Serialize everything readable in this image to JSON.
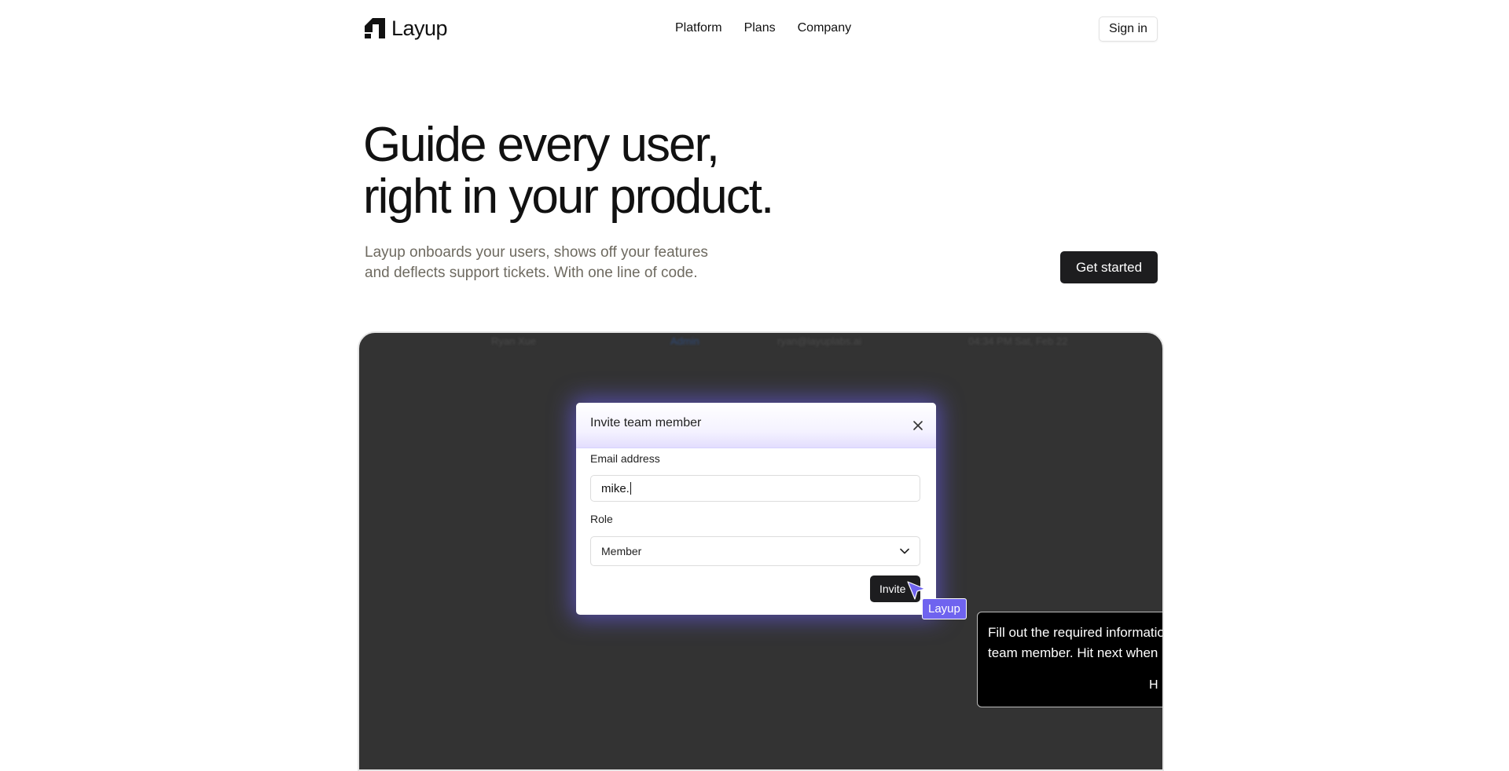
{
  "brand": {
    "name": "Layup"
  },
  "nav": {
    "items": [
      {
        "label": "Platform"
      },
      {
        "label": "Plans"
      },
      {
        "label": "Company"
      }
    ],
    "signin_label": "Sign in"
  },
  "hero": {
    "title_lines": [
      "Guide every user,",
      "right in your product."
    ],
    "subtitle_lines": [
      "Layup onboards your users, shows off your features",
      "and deflects support tickets. With one line of code."
    ],
    "cta_label": "Get started"
  },
  "demo": {
    "background_row": {
      "name": "Ryan Xue",
      "role": "Admin",
      "email": "ryan@layuplabs.ai",
      "time": "04:34 PM Sat, Feb 22"
    },
    "modal": {
      "title": "Invite team member",
      "email_label": "Email address",
      "email_value": "mike.",
      "role_label": "Role",
      "role_value": "Member",
      "invite_label": "Invite"
    },
    "pointer_label": "Layup",
    "tooltip": {
      "lines": [
        "Fill out the required information",
        "team member. Hit next when"
      ],
      "action_label": "H"
    },
    "colors": {
      "frame_background": "#333333",
      "accent": "#6f63ef",
      "modal_glow": "#6e60ff"
    }
  }
}
